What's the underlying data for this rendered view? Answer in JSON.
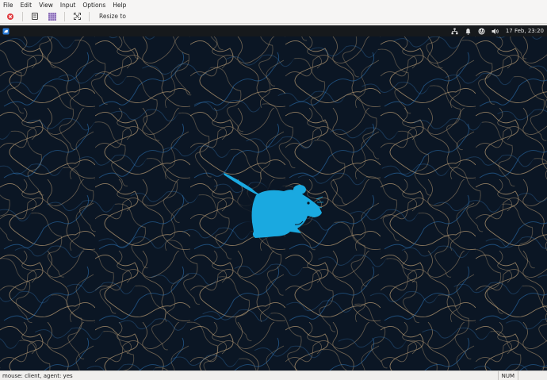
{
  "menu": [
    "File",
    "Edit",
    "View",
    "Input",
    "Options",
    "Help"
  ],
  "toolbar": {
    "resize_label": "Resize to"
  },
  "panel": {
    "clock": "17 Feb, 23:20"
  },
  "status": {
    "message": "mouse: client, agent: yes",
    "num": "NUM"
  },
  "colors": {
    "wallpaper": "#0b1624",
    "mouse_logo": "#1aa9e0",
    "contour_tan": "#b89a72",
    "contour_blue": "#2a6fb0"
  }
}
